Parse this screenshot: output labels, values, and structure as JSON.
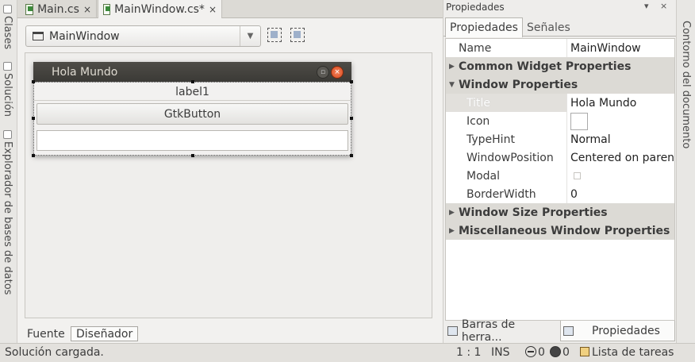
{
  "left_dock": {
    "tabs": [
      {
        "label": "Clases",
        "icon": "classes-icon"
      },
      {
        "label": "Solución",
        "icon": "solution-icon"
      },
      {
        "label": "Explorador de bases de datos",
        "icon": "database-icon"
      }
    ]
  },
  "right_dock": {
    "tabs": [
      {
        "label": "Contorno del documento"
      }
    ]
  },
  "doc_tabs": [
    {
      "label": "Main.cs",
      "close": "×"
    },
    {
      "label": "MainWindow.cs*",
      "close": "×"
    }
  ],
  "designer": {
    "window_combo_value": "MainWindow",
    "preview": {
      "window_title": "Hola Mundo",
      "label_text": "label1",
      "button_text": "GtkButton",
      "close_glyph": "×",
      "min_glyph": "▫"
    },
    "bottom_tabs": [
      "Fuente",
      "Diseñador"
    ]
  },
  "properties_pane": {
    "header": "Propiedades",
    "header_buttons": [
      "▾",
      "×"
    ],
    "tabs": [
      "Propiedades",
      "Señales"
    ],
    "rows": [
      {
        "kind": "prop",
        "name": "Name",
        "value": "MainWindow"
      },
      {
        "kind": "cat",
        "name": "Common Widget Properties",
        "expanded": false
      },
      {
        "kind": "cat",
        "name": "Window Properties",
        "expanded": true
      },
      {
        "kind": "prop",
        "name": "Title",
        "value": "Hola Mundo",
        "selected": true
      },
      {
        "kind": "prop",
        "name": "Icon",
        "value": ""
      },
      {
        "kind": "prop",
        "name": "TypeHint",
        "value": "Normal"
      },
      {
        "kind": "prop",
        "name": "WindowPosition",
        "value": "Centered on parent"
      },
      {
        "kind": "prop",
        "name": "Modal",
        "value": ""
      },
      {
        "kind": "prop",
        "name": "BorderWidth",
        "value": "0"
      },
      {
        "kind": "cat",
        "name": "Window Size Properties",
        "expanded": false
      },
      {
        "kind": "cat",
        "name": "Miscellaneous Window Properties",
        "expanded": false
      }
    ],
    "bottom_tabs": [
      "Barras de herra...",
      "Propiedades"
    ]
  },
  "statusbar": {
    "message": "Solución cargada.",
    "position": "1 : 1",
    "mode": "INS",
    "errors": "0",
    "warnings": "0",
    "task_list": "Lista de tareas"
  }
}
